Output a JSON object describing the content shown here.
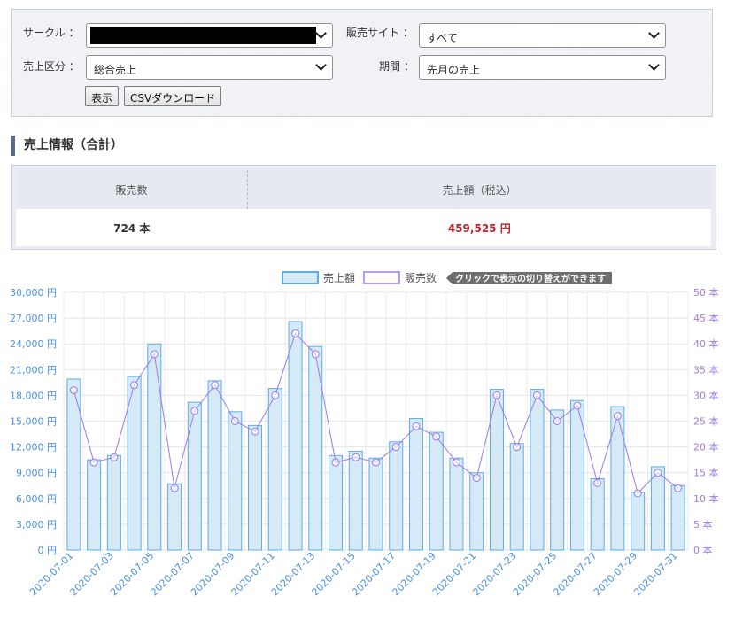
{
  "filters": {
    "circle_label": "サークル ：",
    "circle_value": "",
    "site_label": "販売サイト ：",
    "site_value": "すべて",
    "category_label": "売上区分 ：",
    "category_value": "総合売上",
    "period_label": "期間 ：",
    "period_value": "先月の売上",
    "show_button": "表示",
    "csv_button": "CSVダウンロード"
  },
  "summary": {
    "title": "売上情報（合計）",
    "col_count": "販売数",
    "col_amount": "売上額（税込）",
    "count_value": "724 本",
    "amount_value": "459,525 円"
  },
  "legend": {
    "sales_label": "売上額",
    "count_label": "販売数",
    "hint": "クリックで表示の切り替えができます"
  },
  "colors": {
    "bar_fill": "#d6e9f7",
    "bar_stroke": "#5aaee0",
    "line": "#9b7be8",
    "left_axis_text": "#4a90e2",
    "right_axis_text": "#9b7be8",
    "amount_red": "#b0272d"
  },
  "chart_data": {
    "type": "bar",
    "x": [
      "2020-07-01",
      "2020-07-02",
      "2020-07-03",
      "2020-07-04",
      "2020-07-05",
      "2020-07-06",
      "2020-07-07",
      "2020-07-08",
      "2020-07-09",
      "2020-07-10",
      "2020-07-11",
      "2020-07-12",
      "2020-07-13",
      "2020-07-14",
      "2020-07-15",
      "2020-07-16",
      "2020-07-17",
      "2020-07-18",
      "2020-07-19",
      "2020-07-20",
      "2020-07-21",
      "2020-07-22",
      "2020-07-23",
      "2020-07-24",
      "2020-07-25",
      "2020-07-26",
      "2020-07-27",
      "2020-07-28",
      "2020-07-29",
      "2020-07-30",
      "2020-07-31"
    ],
    "x_tick_labels": [
      "2020-07-01",
      "2020-07-03",
      "2020-07-05",
      "2020-07-07",
      "2020-07-09",
      "2020-07-11",
      "2020-07-13",
      "2020-07-15",
      "2020-07-17",
      "2020-07-19",
      "2020-07-21",
      "2020-07-23",
      "2020-07-25",
      "2020-07-27",
      "2020-07-29",
      "2020-07-31"
    ],
    "series": [
      {
        "name": "売上額",
        "type": "bar",
        "axis": "left",
        "values": [
          19900,
          10500,
          11000,
          20200,
          24000,
          7700,
          17200,
          19700,
          16100,
          14500,
          18800,
          26600,
          23700,
          11000,
          11500,
          10700,
          12600,
          15300,
          13700,
          10700,
          9000,
          18700,
          12400,
          18700,
          16300,
          17400,
          8300,
          16700,
          6700,
          9700,
          7500
        ]
      },
      {
        "name": "販売数",
        "type": "line",
        "axis": "right",
        "values": [
          31,
          17,
          18,
          32,
          38,
          12,
          27,
          32,
          25,
          23,
          30,
          42,
          38,
          17,
          18,
          17,
          20,
          24,
          22,
          17,
          14,
          30,
          20,
          30,
          25,
          28,
          13,
          26,
          11,
          15,
          12
        ]
      }
    ],
    "left_axis": {
      "min": 0,
      "max": 30000,
      "step": 3000,
      "ticks": [
        "0 円",
        "3,000 円",
        "6,000 円",
        "9,000 円",
        "12,000 円",
        "15,000 円",
        "18,000 円",
        "21,000 円",
        "24,000 円",
        "27,000 円",
        "30,000 円"
      ]
    },
    "right_axis": {
      "min": 0,
      "max": 50,
      "step": 5,
      "ticks": [
        "0 本",
        "5 本",
        "10 本",
        "15 本",
        "20 本",
        "25 本",
        "30 本",
        "35 本",
        "40 本",
        "45 本",
        "50 本"
      ]
    },
    "grid": true,
    "legend_position": "top"
  }
}
